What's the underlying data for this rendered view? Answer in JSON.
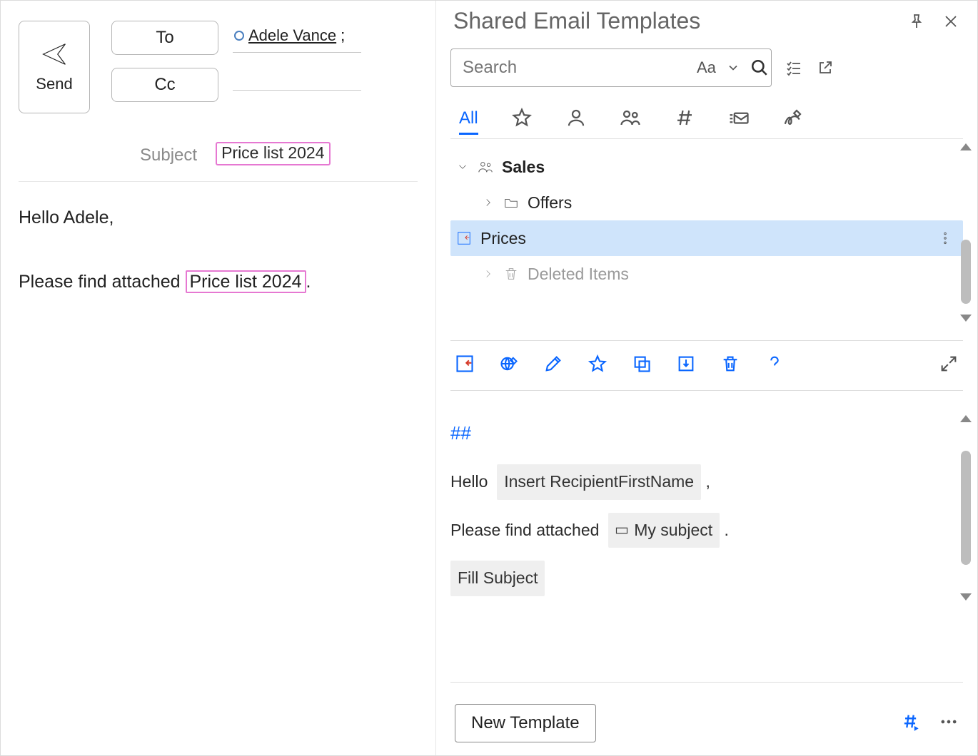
{
  "compose": {
    "send_label": "Send",
    "to_label": "To",
    "cc_label": "Cc",
    "recipient": "Adele Vance",
    "recipient_suffix": ";",
    "subject_label": "Subject",
    "subject_value": "Price list 2024",
    "body_line1": "Hello Adele,",
    "body_line2_before": "Please find attached ",
    "body_line2_hl": "Price list 2024",
    "body_line2_after": "."
  },
  "panel": {
    "title": "Shared Email Templates",
    "search_placeholder": "Search",
    "case_toggle": "Aa",
    "tabs": [
      "All"
    ],
    "tree": {
      "root": "Sales",
      "items": [
        {
          "label": "Offers",
          "icon": "folder",
          "selected": false
        },
        {
          "label": "Prices",
          "icon": "template",
          "selected": true
        },
        {
          "label": "Deleted Items",
          "icon": "trash",
          "selected": false,
          "muted": true
        }
      ]
    },
    "preview": {
      "macro_marker": "##",
      "hello_label": "Hello",
      "chip1": "Insert RecipientFirstName",
      "comma": ",",
      "attached_label": "Please find attached",
      "chip2": "My subject",
      "period": ".",
      "chip3": "Fill Subject"
    },
    "new_template_label": "New Template"
  }
}
